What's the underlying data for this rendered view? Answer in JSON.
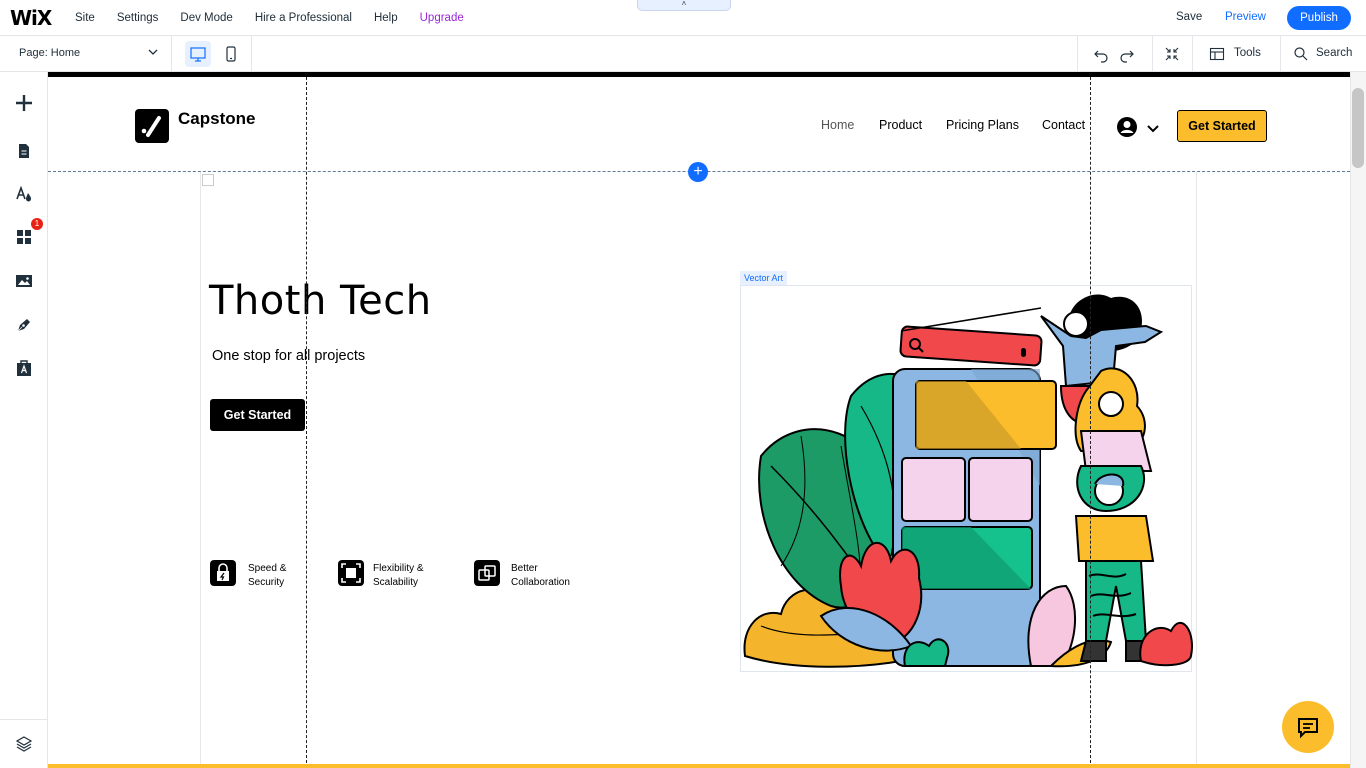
{
  "app": {
    "logo": "WiX",
    "menu": [
      "Site",
      "Settings",
      "Dev Mode",
      "Hire a Professional",
      "Help"
    ],
    "upgrade": "Upgrade",
    "handle": "˄",
    "save": "Save",
    "preview": "Preview",
    "publish": "Publish"
  },
  "subbar": {
    "page_label": "Page: Home",
    "tools": "Tools",
    "search": "Search"
  },
  "sidebar": {
    "badge": "1"
  },
  "site": {
    "brand": "Capstone",
    "nav": [
      "Home",
      "Product",
      "Pricing Plans",
      "Contact"
    ],
    "cta": "Get Started",
    "hero_title": "Thoth Tech",
    "hero_sub": "One stop for all projects",
    "hero_button": "Get Started",
    "features": [
      {
        "line1": "Speed &",
        "line2": "Security"
      },
      {
        "line1": "Flexibility &",
        "line2": "Scalability"
      },
      {
        "line1": "Better",
        "line2": "Collaboration"
      }
    ],
    "vector_label": "Vector Art"
  },
  "colors": {
    "accent": "#116dff",
    "cta": "#fbbd2b",
    "upgrade": "#9a27d5"
  }
}
